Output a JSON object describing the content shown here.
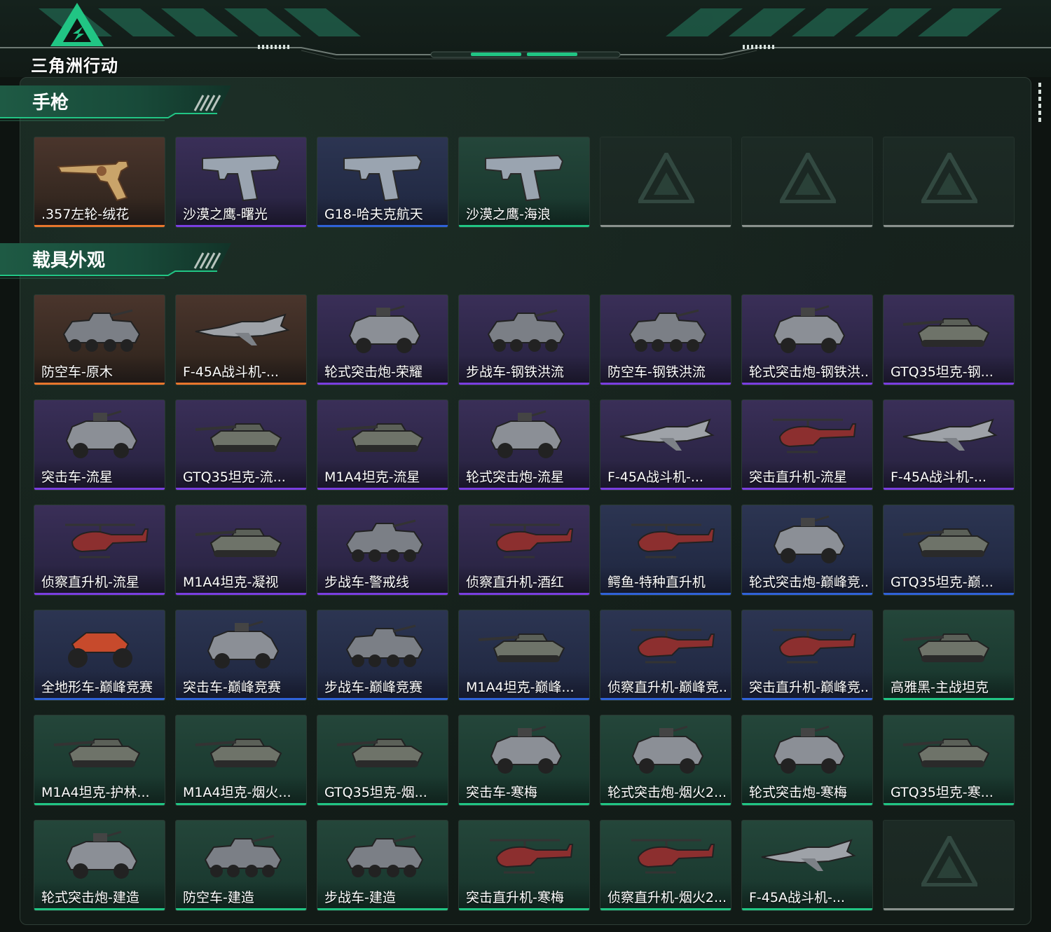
{
  "app": {
    "logo_text": "三角洲行动"
  },
  "colors": {
    "accent": "#21c584",
    "rarity_orange": "#e8762c",
    "rarity_purple": "#7a3ee0",
    "rarity_blue": "#2f62d8",
    "rarity_green": "#21c584",
    "empty": "#8a918d"
  },
  "sections": [
    {
      "title": "手枪",
      "items": [
        {
          "name": ".357左轮-绒花",
          "rarity": "orange",
          "icon": "revolver-icon"
        },
        {
          "name": "沙漠之鹰-曙光",
          "rarity": "purple",
          "icon": "pistol-icon"
        },
        {
          "name": "G18-哈夫克航天",
          "rarity": "blue",
          "icon": "pistol-icon"
        },
        {
          "name": "沙漠之鹰-海浪",
          "rarity": "green",
          "icon": "pistol-icon"
        },
        {
          "name": "",
          "rarity": "empty",
          "icon": "delta-logo-icon"
        },
        {
          "name": "",
          "rarity": "empty",
          "icon": "delta-logo-icon"
        },
        {
          "name": "",
          "rarity": "empty",
          "icon": "delta-logo-icon"
        }
      ]
    },
    {
      "title": "载具外观",
      "items": [
        {
          "name": "防空车-原木",
          "rarity": "orange",
          "icon": "apc-icon"
        },
        {
          "name": "F-45A战斗机-...",
          "rarity": "orange",
          "icon": "jet-icon"
        },
        {
          "name": "轮式突击炮-荣耀",
          "rarity": "purple",
          "icon": "armored-car-icon"
        },
        {
          "name": "步战车-钢铁洪流",
          "rarity": "purple",
          "icon": "apc-icon"
        },
        {
          "name": "防空车-钢铁洪流",
          "rarity": "purple",
          "icon": "apc-icon"
        },
        {
          "name": "轮式突击炮-钢铁洪...",
          "rarity": "purple",
          "icon": "armored-car-icon"
        },
        {
          "name": "GTQ35坦克-钢...",
          "rarity": "purple",
          "icon": "tank-icon"
        },
        {
          "name": "突击车-流星",
          "rarity": "purple",
          "icon": "armored-car-icon"
        },
        {
          "name": "GTQ35坦克-流...",
          "rarity": "purple",
          "icon": "tank-icon"
        },
        {
          "name": "M1A4坦克-流星",
          "rarity": "purple",
          "icon": "tank-icon"
        },
        {
          "name": "轮式突击炮-流星",
          "rarity": "purple",
          "icon": "armored-car-icon"
        },
        {
          "name": "F-45A战斗机-...",
          "rarity": "purple",
          "icon": "jet-icon"
        },
        {
          "name": "突击直升机-流星",
          "rarity": "purple",
          "icon": "helicopter-icon"
        },
        {
          "name": "F-45A战斗机-...",
          "rarity": "purple",
          "icon": "jet-icon"
        },
        {
          "name": "侦察直升机-流星",
          "rarity": "purple",
          "icon": "helicopter-icon"
        },
        {
          "name": "M1A4坦克-凝视",
          "rarity": "purple",
          "icon": "tank-icon"
        },
        {
          "name": "步战车-警戒线",
          "rarity": "purple",
          "icon": "apc-icon"
        },
        {
          "name": "侦察直升机-酒红",
          "rarity": "purple",
          "icon": "helicopter-icon"
        },
        {
          "name": "鳄鱼-特种直升机",
          "rarity": "blue",
          "icon": "helicopter-icon"
        },
        {
          "name": "轮式突击炮-巅峰竞...",
          "rarity": "blue",
          "icon": "armored-car-icon"
        },
        {
          "name": "GTQ35坦克-巅...",
          "rarity": "blue",
          "icon": "tank-icon"
        },
        {
          "name": "全地形车-巅峰竞赛",
          "rarity": "blue",
          "icon": "atv-icon"
        },
        {
          "name": "突击车-巅峰竞赛",
          "rarity": "blue",
          "icon": "armored-car-icon"
        },
        {
          "name": "步战车-巅峰竞赛",
          "rarity": "blue",
          "icon": "apc-icon"
        },
        {
          "name": "M1A4坦克-巅峰...",
          "rarity": "blue",
          "icon": "tank-icon"
        },
        {
          "name": "侦察直升机-巅峰竞...",
          "rarity": "blue",
          "icon": "helicopter-icon"
        },
        {
          "name": "突击直升机-巅峰竞...",
          "rarity": "blue",
          "icon": "helicopter-icon"
        },
        {
          "name": "高雅黑-主战坦克",
          "rarity": "green",
          "icon": "tank-icon"
        },
        {
          "name": "M1A4坦克-护林...",
          "rarity": "green",
          "icon": "tank-icon"
        },
        {
          "name": "M1A4坦克-烟火...",
          "rarity": "green",
          "icon": "tank-icon"
        },
        {
          "name": "GTQ35坦克-烟...",
          "rarity": "green",
          "icon": "tank-icon"
        },
        {
          "name": "突击车-寒梅",
          "rarity": "green",
          "icon": "armored-car-icon"
        },
        {
          "name": "轮式突击炮-烟火2...",
          "rarity": "green",
          "icon": "armored-car-icon"
        },
        {
          "name": "轮式突击炮-寒梅",
          "rarity": "green",
          "icon": "armored-car-icon"
        },
        {
          "name": "GTQ35坦克-寒...",
          "rarity": "green",
          "icon": "tank-icon"
        },
        {
          "name": "轮式突击炮-建造",
          "rarity": "green",
          "icon": "armored-car-icon"
        },
        {
          "name": "防空车-建造",
          "rarity": "green",
          "icon": "apc-icon"
        },
        {
          "name": "步战车-建造",
          "rarity": "green",
          "icon": "apc-icon"
        },
        {
          "name": "突击直升机-寒梅",
          "rarity": "green",
          "icon": "helicopter-icon"
        },
        {
          "name": "侦察直升机-烟火2...",
          "rarity": "green",
          "icon": "helicopter-icon"
        },
        {
          "name": "F-45A战斗机-...",
          "rarity": "green",
          "icon": "jet-icon"
        },
        {
          "name": "",
          "rarity": "empty",
          "icon": "delta-logo-icon"
        }
      ]
    }
  ]
}
